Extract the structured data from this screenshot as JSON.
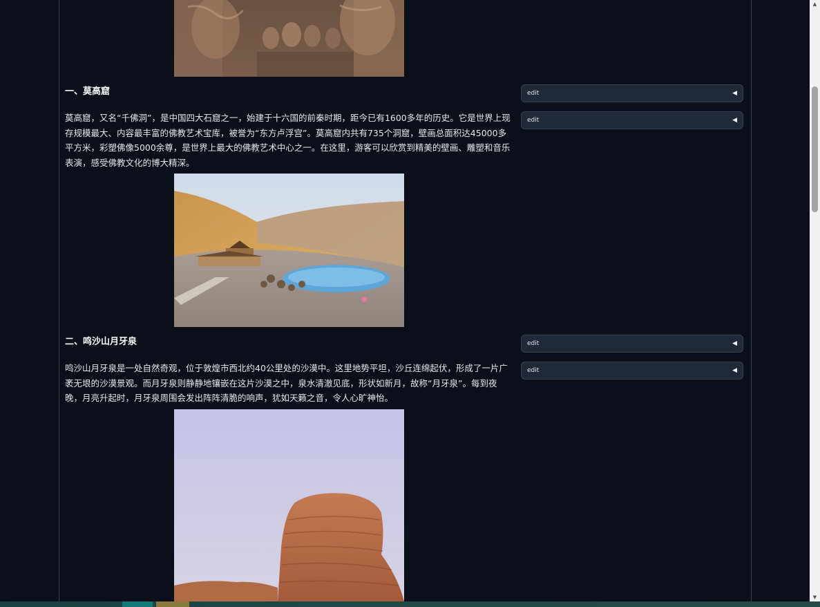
{
  "sections": [
    {
      "heading": "一、莫高窟",
      "paragraph": "莫高窟，又名“千佛洞”，是中国四大石窟之一，始建于十六国的前秦时期，距今已有1600多年的历史。它是世界上现存规模最大、内容最丰富的佛教艺术宝库，被誉为“东方卢浮宫”。莫高窟内共有735个洞窟，壁画总面积达45000多平方米，彩塑佛像5000余尊，是世界上最大的佛教艺术中心之一。在这里，游客可以欣赏到精美的壁画、雕塑和音乐表演，感受佛教文化的博大精深。"
    },
    {
      "heading": "二、鸣沙山月牙泉",
      "paragraph": "鸣沙山月牙泉是一处自然奇观，位于敦煌市西北约40公里处的沙漠中。这里地势平坦，沙丘连绵起伏，形成了一片广袤无垠的沙漠景观。而月牙泉则静静地镶嵌在这片沙漠之中，泉水清澈见底，形状如新月，故称“月牙泉”。每到夜晚，月亮升起时，月牙泉周围会发出阵阵清脆的响声，犹如天籁之音，令人心旷神怡。"
    }
  ],
  "edit_buttons": [
    {
      "label": "edit",
      "icon": "triangle-left-icon"
    },
    {
      "label": "edit",
      "icon": "triangle-left-icon"
    },
    {
      "label": "edit",
      "icon": "triangle-left-icon"
    },
    {
      "label": "edit",
      "icon": "triangle-left-icon"
    }
  ],
  "colors": {
    "page_background": "#0b0f19",
    "button_background": "#1f2937",
    "border": "#374151"
  }
}
